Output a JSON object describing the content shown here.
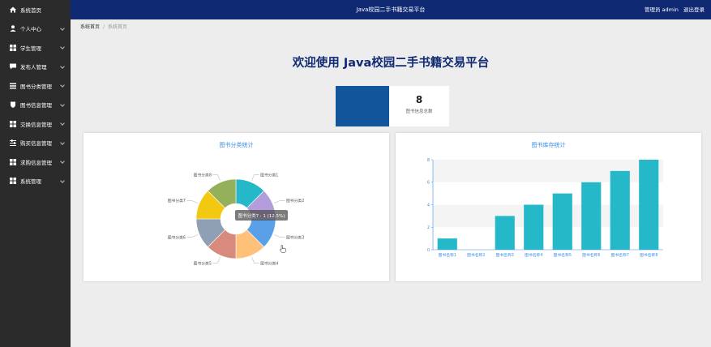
{
  "sidebar": {
    "items": [
      {
        "label": "系统首页",
        "icon": "home-icon"
      },
      {
        "label": "个人中心",
        "icon": "user-icon"
      },
      {
        "label": "学生管理",
        "icon": "grid-icon"
      },
      {
        "label": "发布人管理",
        "icon": "chat-icon"
      },
      {
        "label": "图书分类管理",
        "icon": "list-icon"
      },
      {
        "label": "图书信息管理",
        "icon": "shield-icon"
      },
      {
        "label": "交换信息管理",
        "icon": "grid-icon"
      },
      {
        "label": "购买信息管理",
        "icon": "sliders-icon"
      },
      {
        "label": "求购信息管理",
        "icon": "grid-icon"
      },
      {
        "label": "系统管理",
        "icon": "grid-icon"
      }
    ]
  },
  "header": {
    "title": "Java校园二手书籍交易平台",
    "user": "管理员 admin",
    "logout": "退出登录"
  },
  "breadcrumb": {
    "home": "系统首页",
    "current": "系统首页"
  },
  "welcome": "欢迎使用 Java校园二手书籍交易平台",
  "stat": {
    "value": "8",
    "label": "图书信息总数"
  },
  "colors": {
    "header": "#0f2a73",
    "sidebar": "#2b2b2b",
    "bar": "#25b8c9",
    "stat": "#12559b"
  },
  "chart_data": [
    {
      "type": "pie",
      "title": "图书分类统计",
      "categories": [
        "图书分类1",
        "图书分类2",
        "图书分类3",
        "图书分类4",
        "图书分类5",
        "图书分类6",
        "图书分类7",
        "图书分类8"
      ],
      "values": [
        1,
        1,
        1,
        1,
        1,
        1,
        1,
        1
      ],
      "colors": [
        "#25b8c9",
        "#b39ddb",
        "#5aa0e8",
        "#ffc07a",
        "#d98a7e",
        "#8fa0b5",
        "#f2c811",
        "#95b05a"
      ],
      "tooltip": "图书分类7 : 1 (12.5%)"
    },
    {
      "type": "bar",
      "title": "图书库存统计",
      "categories": [
        "图书名称1",
        "图书名称2",
        "图书名称3",
        "图书名称4",
        "图书名称5",
        "图书名称6",
        "图书名称7",
        "图书名称8"
      ],
      "values": [
        1,
        0,
        3,
        4,
        5,
        6,
        7,
        8
      ],
      "ylim": [
        0,
        8
      ],
      "yticks": [
        "0",
        "2",
        "4",
        "6",
        "8"
      ],
      "color": "#25b8c9"
    }
  ]
}
